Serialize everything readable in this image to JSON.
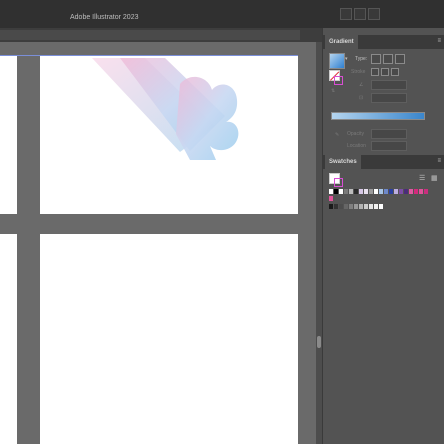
{
  "app": {
    "window_title": "Adobe Illustrator 2023"
  },
  "gradient_panel": {
    "tab_label": "Gradient",
    "type_label": "Type:",
    "stroke_label": "Stroke",
    "opacity_label": "Opacity",
    "location_label": "Location",
    "ramp_start_color": "#b4d4ee",
    "ramp_end_color": "#3a86cc"
  },
  "swatches_panel": {
    "tab_label": "Swatches",
    "row1_colors": [
      "#ffffff",
      "#000000",
      "#ffffff",
      "#7a7a7a",
      "#bcbcbc",
      "#2b2b2b",
      "#d7c8e6",
      "#e8e0ee",
      "#9b9b9b",
      "#ffffff",
      "#a8c5e6",
      "#6d88c9",
      "#2a3fa0",
      "#bdaee0",
      "#7c4ea6",
      "#4b2c7a",
      "#e05aa2",
      "#d4297d",
      "#e0539a",
      "#c92e7e"
    ],
    "row2_colors": [
      "#1a1a1a",
      "#333333",
      "#4d4d4d",
      "#666666",
      "#808080",
      "#999999",
      "#b3b3b3",
      "#cccccc",
      "#e6e6e6",
      "#f2f2f2",
      "#ffffff"
    ]
  },
  "colors": {
    "accent": "#2f80d1",
    "gradient_pink": "#e8a6c8",
    "gradient_blue": "#a6d2ee",
    "artboard_outline": "#7b8fd9"
  }
}
